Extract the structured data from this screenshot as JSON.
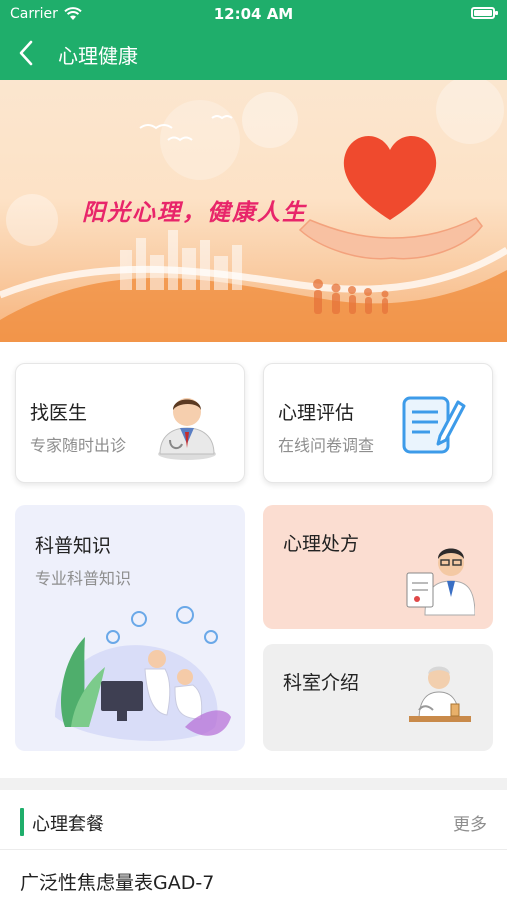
{
  "status_bar": {
    "carrier": "Carrier",
    "time": "12:04 AM"
  },
  "nav": {
    "title": "心理健康"
  },
  "banner": {
    "slogan": "阳光心理，健康人生"
  },
  "cards": {
    "find_doctor": {
      "title": "找医生",
      "subtitle": "专家随时出诊"
    },
    "assessment": {
      "title": "心理评估",
      "subtitle": "在线问卷调查"
    },
    "knowledge": {
      "title": "科普知识",
      "subtitle": "专业科普知识"
    },
    "prescription": {
      "title": "心理处方"
    },
    "department": {
      "title": "科室介绍"
    }
  },
  "package_section": {
    "title": "心理套餐",
    "more_label": "更多"
  },
  "packages": [
    {
      "name": "广泛性焦虑量表GAD-7"
    }
  ],
  "colors": {
    "brand": "#1fae6b",
    "prescription_bg": "#fbddd1",
    "knowledge_bg": "#eef0fb",
    "department_bg": "#efefef",
    "slogan": "#e8256a"
  }
}
